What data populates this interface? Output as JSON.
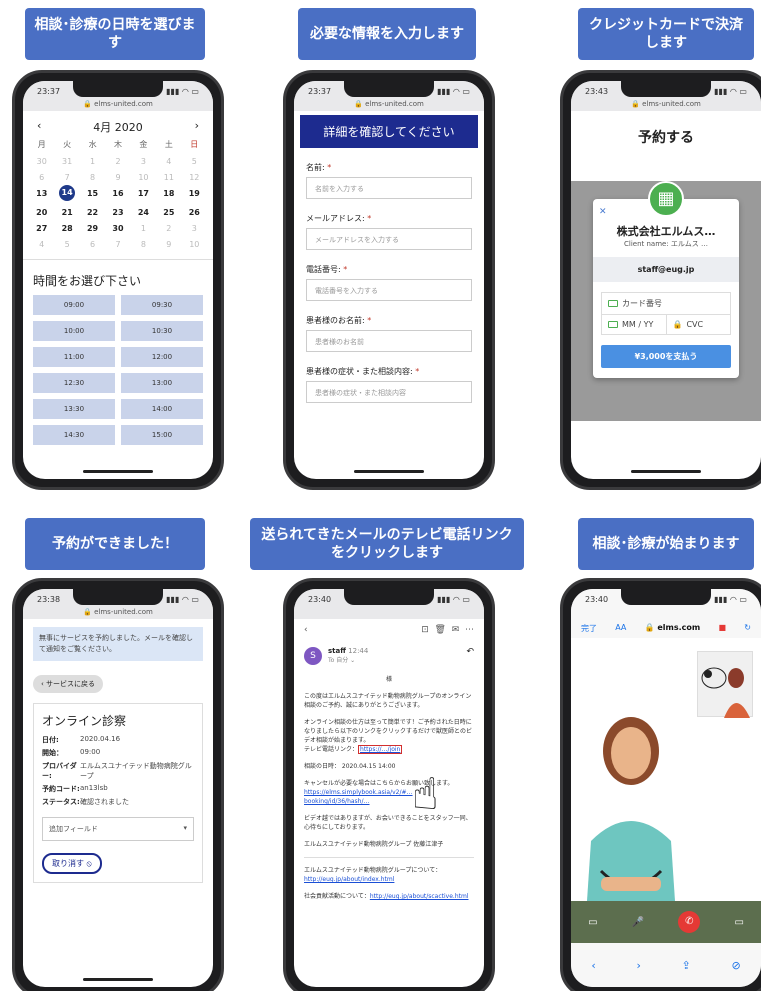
{
  "steps": [
    {
      "title": "相談･診療の日時を選びます"
    },
    {
      "title": "必要な情報を入力します"
    },
    {
      "title": "クレジットカードで決済します"
    },
    {
      "title": "予約ができました！"
    },
    {
      "title": "送られてきたメールのテレビ電話リンクをクリックします"
    },
    {
      "title": "相談･診療が始まります"
    }
  ],
  "phone1": {
    "time": "23:37",
    "url": "elms-united.com",
    "month": "4月 2020",
    "weekdays": [
      "月",
      "火",
      "水",
      "木",
      "金",
      "土",
      "日"
    ],
    "days": [
      "30",
      "31",
      "1",
      "2",
      "3",
      "4",
      "5",
      "6",
      "7",
      "8",
      "9",
      "10",
      "11",
      "12",
      "13",
      "14",
      "15",
      "16",
      "17",
      "18",
      "19",
      "20",
      "21",
      "22",
      "23",
      "24",
      "25",
      "26",
      "27",
      "28",
      "29",
      "30",
      "1",
      "2",
      "3",
      "4",
      "5",
      "6",
      "7",
      "8",
      "9",
      "10"
    ],
    "time_title": "時間をお選び下さい",
    "slots": [
      "09:00",
      "09:30",
      "10:00",
      "10:30",
      "11:00",
      "12:00",
      "12:30",
      "13:00",
      "13:30",
      "14:00",
      "14:30",
      "15:00"
    ]
  },
  "phone2": {
    "time": "23:37",
    "url": "elms-united.com",
    "banner": "詳細を確認してください",
    "fields": [
      {
        "label": "名前:",
        "placeholder": "名前を入力する"
      },
      {
        "label": "メールアドレス:",
        "placeholder": "メールアドレスを入力する"
      },
      {
        "label": "電話番号:",
        "placeholder": "電話番号を入力する"
      },
      {
        "label": "患者様のお名前:",
        "placeholder": "患者様のお名前"
      },
      {
        "label": "患者様の症状・また相談内容:",
        "placeholder": "患者様の症状・また相談内容"
      }
    ]
  },
  "phone3": {
    "time": "23:43",
    "url": "elms-united.com",
    "title": "予約する",
    "company": "株式会社エルムス…",
    "client": "Client name: エルムス …",
    "email": "staff@eug.jp",
    "card_placeholder": "カード番号",
    "expiry_placeholder": "MM / YY",
    "cvc_placeholder": "CVC",
    "pay_label": "¥3,000を支払う"
  },
  "phone4": {
    "time": "23:38",
    "url": "elms-united.com",
    "notice": "無事にサービスを予約しました。メールを確認して通知をご覧ください。",
    "back_label": "サービスに戻る",
    "service_title": "オンライン診察",
    "rows": [
      {
        "k": "日付:",
        "v": "2020.04.16"
      },
      {
        "k": "開始：",
        "v": "09:00"
      },
      {
        "k": "プロバイダー:",
        "v": "エルムスユナイテッド動物病院グループ"
      },
      {
        "k": "予約コード:",
        "v": "an13lsb"
      },
      {
        "k": "ステータス:",
        "v": "確認されました"
      }
    ],
    "add_field": "追加フィールド",
    "cancel_label": "取り消す"
  },
  "phone5": {
    "time": "23:40",
    "sender": "staff",
    "sent_time": "12:44",
    "to": "To 自分 ⌄",
    "greeting": "様",
    "p1": "この度はエルムスユナイテッド動物病院グループのオンライン相談のご予約、誠にありがとうございます。",
    "p2": "オンライン相談の仕方は至って簡単です！ご予約された日時になりましたら以下のリンクをクリックするだけで獣医師とのビデオ相談が始まります。",
    "link_label": "テレビ電話リンク：",
    "date_line": "相談の日時： 2020.04.15 14:00",
    "p3": "キャンセルが必要な場合はこちらからお願い致します。",
    "cancel_link": "https://elms.simplybook.asia/v2/#…booking/id/36/hash/…",
    "p4": "ビデオ越ではありますが、お会いできることをスタッフ一同、心待ちにしております。",
    "sign": "エルムスユナイテッド動物病院グループ 佐藤江津子",
    "about": "エルムスユナイテッド動物病院グループについて：",
    "about_link": "http://eug.jp/about/index.html",
    "social": "社会貢献活動について：",
    "social_link": "http://eug.jp/about/scactive.html"
  },
  "phone6": {
    "time": "23:40",
    "done": "完了",
    "aa": "AA",
    "url": "elms.com"
  }
}
